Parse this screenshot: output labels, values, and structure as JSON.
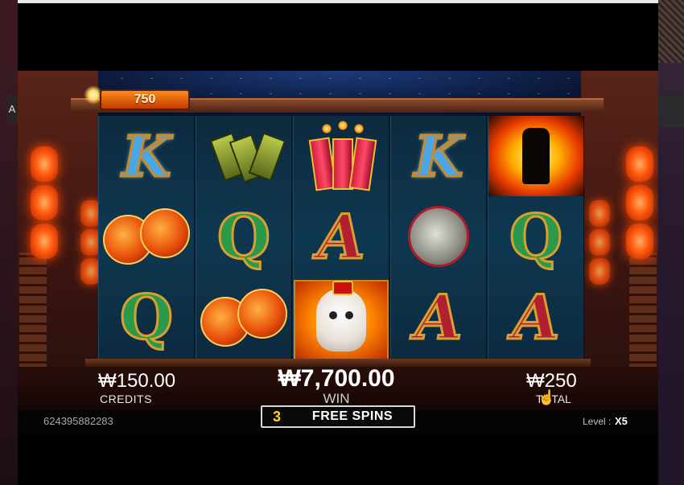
{
  "colors": {
    "accent": "#ffcf2a",
    "jackpot": "#ff8a1a",
    "reel_bg": "#0e3850",
    "outer": "#241016"
  },
  "outer": {
    "left_tab_label": "A"
  },
  "jackpot": {
    "value": "750"
  },
  "reels": [
    {
      "symbols": [
        "K",
        "bells",
        "Q"
      ]
    },
    {
      "symbols": [
        "lanterns",
        "Q",
        "lanterns"
      ]
    },
    {
      "symbols": [
        "firecrackers",
        "A",
        "alpaca"
      ]
    },
    {
      "symbols": [
        "K",
        "gong",
        "A"
      ]
    },
    {
      "symbols": [
        "wolf",
        "Q",
        "A"
      ]
    }
  ],
  "credits": {
    "value": "₩150.00",
    "label": "CREDITS"
  },
  "win": {
    "value": "₩7,700.00",
    "label": "WIN"
  },
  "total": {
    "value": "₩250",
    "label": "TOTAL"
  },
  "free_spins": {
    "count": "3",
    "label": "FREE SPINS"
  },
  "session_id": "624395882283",
  "level": {
    "label": "Level :",
    "value": "X5"
  }
}
